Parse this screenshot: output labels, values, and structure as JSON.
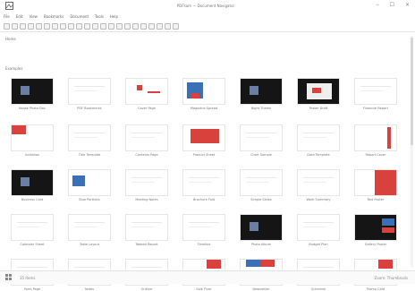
{
  "window": {
    "app_icon": "photos-app-icon",
    "title": "PDFsam — Document Navigator",
    "controls": [
      "–",
      "☐",
      "×"
    ]
  },
  "menu": [
    "File",
    "Edit",
    "View",
    "Bookmarks",
    "Document",
    "Tools",
    "Help"
  ],
  "breadcrumb": "Home",
  "group_label": "Examples",
  "thumbnails": [
    {
      "caption": "Kodak Photo Doc",
      "style": "dark"
    },
    {
      "caption": "PDF Bookmarks",
      "style": "plain"
    },
    {
      "caption": "Cover Page",
      "style": "redlines"
    },
    {
      "caption": "Magazine Spread",
      "style": "blue"
    },
    {
      "caption": "Night Theme",
      "style": "dark"
    },
    {
      "caption": "Poster Draft",
      "style": "darkframe"
    },
    {
      "caption": "Financial Report",
      "style": "plain"
    },
    {
      "caption": "Invitation",
      "style": "redheader"
    },
    {
      "caption": "Title Template",
      "style": "plain"
    },
    {
      "caption": "Contents Page",
      "style": "plain"
    },
    {
      "caption": "Product Sheet",
      "style": "redblock"
    },
    {
      "caption": "Chart Sample",
      "style": "plain"
    },
    {
      "caption": "Data Template",
      "style": "plain"
    },
    {
      "caption": "Report Cover",
      "style": "redbar"
    },
    {
      "caption": "Business Card",
      "style": "dark"
    },
    {
      "caption": "Blue Portfolio",
      "style": "bluebox"
    },
    {
      "caption": "Meeting Notes",
      "style": "plain"
    },
    {
      "caption": "Brochure Fold",
      "style": "plain"
    },
    {
      "caption": "Simple Slides",
      "style": "plain"
    },
    {
      "caption": "Work Summary",
      "style": "plain"
    },
    {
      "caption": "Red Poster",
      "style": "redsplit"
    },
    {
      "caption": "Calendar Sheet",
      "style": "plain"
    },
    {
      "caption": "Table Layout",
      "style": "plain"
    },
    {
      "caption": "Tabbed Report",
      "style": "plain"
    },
    {
      "caption": "Timeline",
      "style": "plain"
    },
    {
      "caption": "Photo Album",
      "style": "dark"
    },
    {
      "caption": "Budget Plan",
      "style": "plain"
    },
    {
      "caption": "Gallery Poster",
      "style": "darkcolor"
    },
    {
      "caption": "Form Page",
      "style": "plain"
    },
    {
      "caption": "Notes",
      "style": "plain"
    },
    {
      "caption": "Outline",
      "style": "plain"
    },
    {
      "caption": "Sale Flyer",
      "style": "redcorner"
    },
    {
      "caption": "Newsletter",
      "style": "bluered"
    },
    {
      "caption": "Schedule",
      "style": "plain"
    },
    {
      "caption": "Promo Card",
      "style": "redcorner"
    }
  ],
  "status": {
    "left_icon": "grid-view-icon",
    "text": "35 items",
    "right": "Zoom: Thumbnails"
  },
  "colors": {
    "accent_red": "#d9423c",
    "accent_blue": "#3b6fb6",
    "dark": "#151515"
  }
}
